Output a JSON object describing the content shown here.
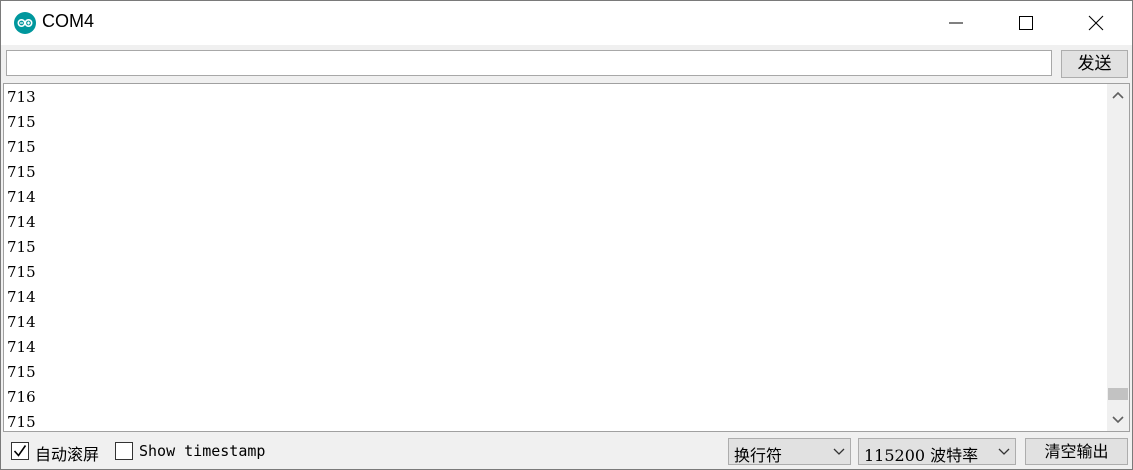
{
  "window": {
    "title": "COM4",
    "accent": "#00979d"
  },
  "toolbar": {
    "input_value": "",
    "send_label": "发送"
  },
  "output": {
    "lines": [
      "713",
      "715",
      "715",
      "715",
      "714",
      "714",
      "715",
      "715",
      "714",
      "714",
      "714",
      "715",
      "716",
      "715"
    ],
    "scroll_position": 0.97
  },
  "footer": {
    "autoscroll": {
      "label": "自动滚屏",
      "checked": true
    },
    "timestamp": {
      "label": "Show timestamp",
      "checked": false
    },
    "line_ending": "换行符",
    "baud_rate": "115200 波特率",
    "clear_label": "清空输出"
  },
  "icons": {
    "app": "arduino-icon",
    "minimize": "minimize-icon",
    "maximize": "maximize-icon",
    "close": "close-icon"
  }
}
